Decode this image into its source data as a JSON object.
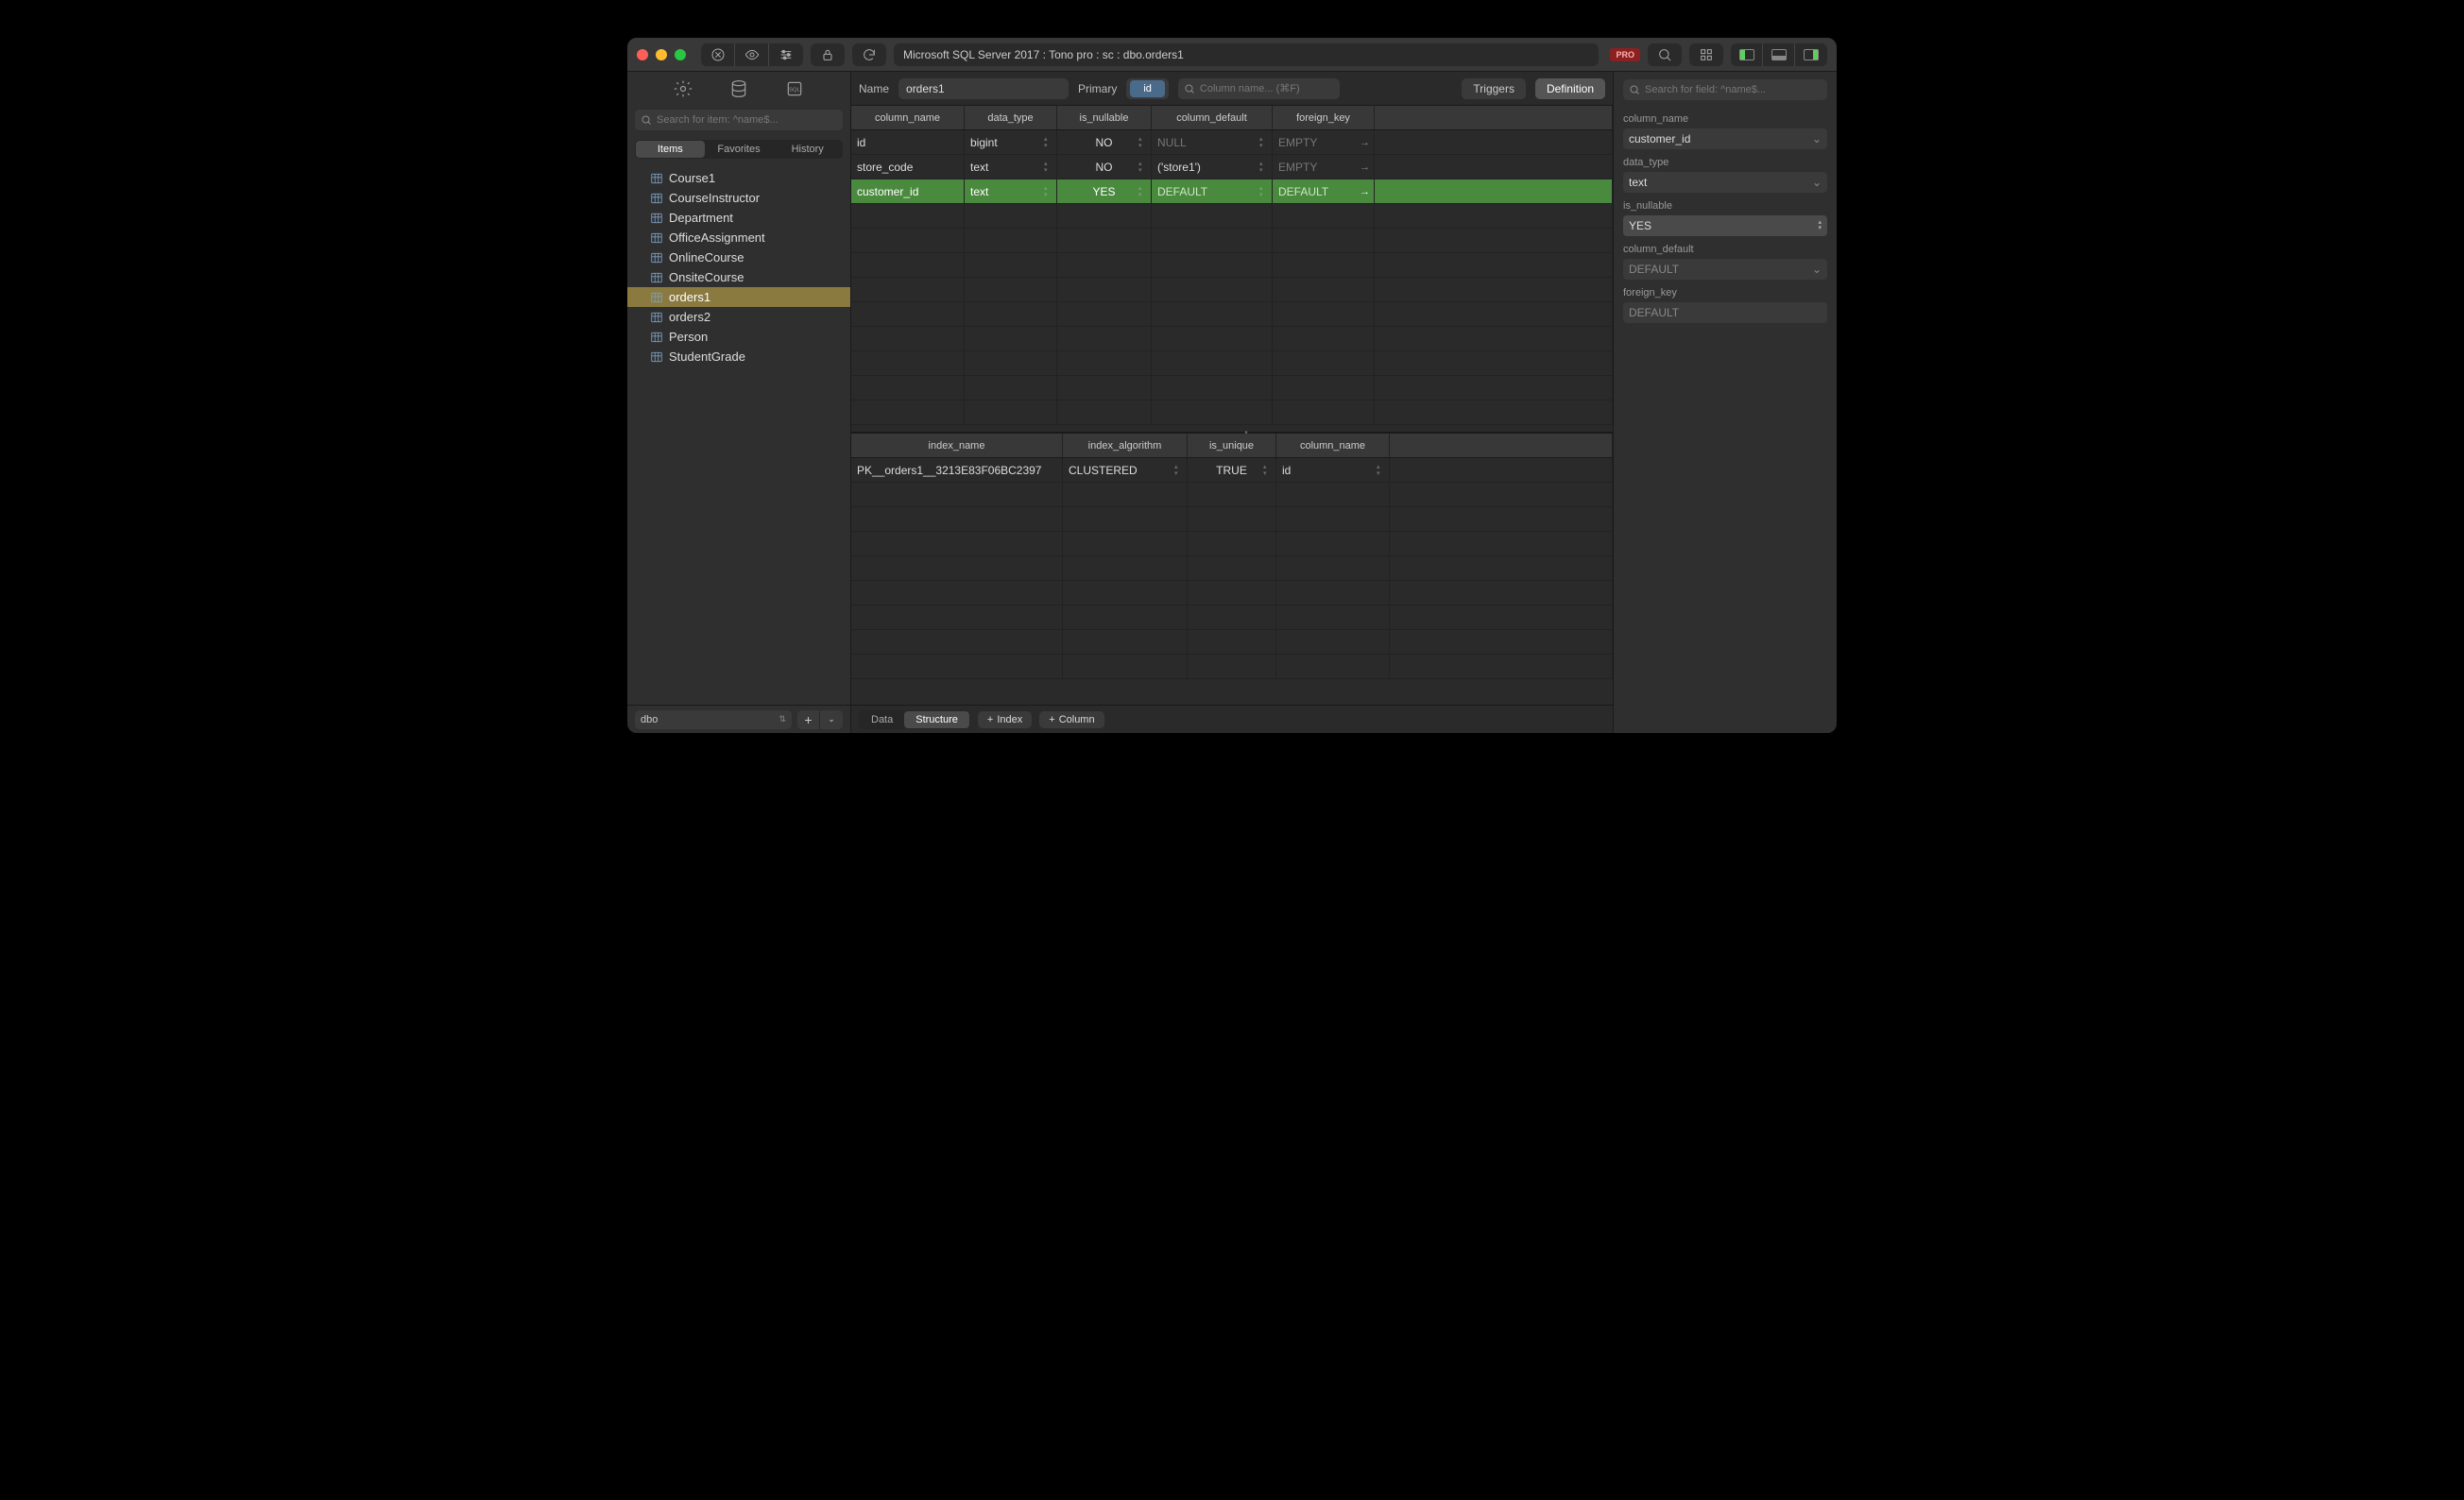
{
  "titlebar": {
    "path": "Microsoft SQL Server 2017 : Tono pro : sc : dbo.orders1",
    "pro_badge": "PRO"
  },
  "sidebar": {
    "search_placeholder": "Search for item: ^name$...",
    "tabs": {
      "items": "Items",
      "favorites": "Favorites",
      "history": "History"
    },
    "tables": [
      {
        "name": "Course1"
      },
      {
        "name": "CourseInstructor"
      },
      {
        "name": "Department"
      },
      {
        "name": "OfficeAssignment"
      },
      {
        "name": "OnlineCourse"
      },
      {
        "name": "OnsiteCourse"
      },
      {
        "name": "orders1"
      },
      {
        "name": "orders2"
      },
      {
        "name": "Person"
      },
      {
        "name": "StudentGrade"
      }
    ],
    "schema": "dbo"
  },
  "main": {
    "name_label": "Name",
    "name_value": "orders1",
    "primary_label": "Primary",
    "primary_value": "id",
    "col_search_placeholder": "Column name... (⌘F)",
    "triggers_btn": "Triggers",
    "definition_btn": "Definition",
    "columns": {
      "headers": {
        "name": "column_name",
        "type": "data_type",
        "nullable": "is_nullable",
        "default": "column_default",
        "fk": "foreign_key"
      },
      "rows": [
        {
          "name": "id",
          "type": "bigint",
          "nullable": "NO",
          "default": "NULL",
          "default_dim": true,
          "fk": "EMPTY",
          "fk_dim": true
        },
        {
          "name": "store_code",
          "type": "text",
          "nullable": "NO",
          "default": "('store1')",
          "default_dim": false,
          "fk": "EMPTY",
          "fk_dim": true
        },
        {
          "name": "customer_id",
          "type": "text",
          "nullable": "YES",
          "default": "DEFAULT",
          "default_dim": true,
          "fk": "DEFAULT",
          "fk_dim": true,
          "selected": true
        }
      ]
    },
    "indexes": {
      "headers": {
        "name": "index_name",
        "alg": "index_algorithm",
        "unique": "is_unique",
        "col": "column_name"
      },
      "rows": [
        {
          "name": "PK__orders1__3213E83F06BC2397",
          "alg": "CLUSTERED",
          "unique": "TRUE",
          "col": "id"
        }
      ]
    },
    "footer": {
      "data": "Data",
      "structure": "Structure",
      "add_index": "Index",
      "add_column": "Column"
    }
  },
  "inspector": {
    "search_placeholder": "Search for field: ^name$...",
    "fields": {
      "column_name": {
        "label": "column_name",
        "value": "customer_id"
      },
      "data_type": {
        "label": "data_type",
        "value": "text"
      },
      "is_nullable": {
        "label": "is_nullable",
        "value": "YES"
      },
      "column_default": {
        "label": "column_default",
        "value": "DEFAULT"
      },
      "foreign_key": {
        "label": "foreign_key",
        "value": "DEFAULT"
      }
    }
  }
}
